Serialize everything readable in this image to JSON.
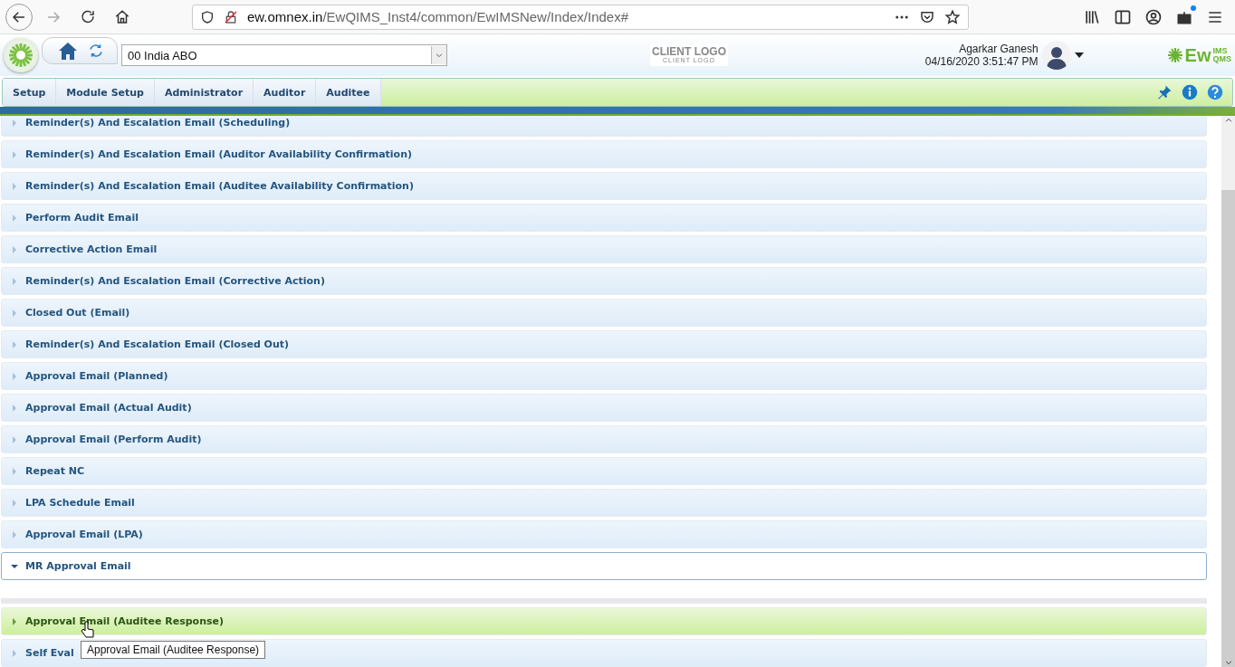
{
  "browser": {
    "url_host": "ew.omnex.in",
    "url_path": "/EwQIMS_Inst4/common/EwIMSNew/Index/Index#",
    "notification_dot": true
  },
  "header": {
    "site_select": "00 India ABO",
    "client_logo": "CLIENT LOGO",
    "client_logo_sub": "CLIENT LOGO",
    "user_name": "Agarkar Ganesh",
    "datetime": "04/16/2020 3:51:47 PM",
    "brand": "Ew",
    "brand_sup": "IMS",
    "brand_sub": "QMS"
  },
  "nav": {
    "items": [
      {
        "label": "Setup"
      },
      {
        "label": "Module Setup"
      },
      {
        "label": "Administrator"
      },
      {
        "label": "Auditor"
      },
      {
        "label": "Auditee"
      }
    ]
  },
  "sections": [
    {
      "label": "Reminder(s) And Escalation Email (Scheduling)",
      "expanded": false,
      "hovered": false
    },
    {
      "label": "Reminder(s) And Escalation Email (Auditor Availability Confirmation)",
      "expanded": false,
      "hovered": false
    },
    {
      "label": "Reminder(s) And Escalation Email (Auditee Availability Confirmation)",
      "expanded": false,
      "hovered": false
    },
    {
      "label": "Perform Audit Email",
      "expanded": false,
      "hovered": false
    },
    {
      "label": "Corrective Action Email",
      "expanded": false,
      "hovered": false
    },
    {
      "label": "Reminder(s) And Escalation Email (Corrective Action)",
      "expanded": false,
      "hovered": false
    },
    {
      "label": "Closed Out (Email)",
      "expanded": false,
      "hovered": false
    },
    {
      "label": "Reminder(s) And Escalation Email (Closed Out)",
      "expanded": false,
      "hovered": false
    },
    {
      "label": "Approval Email (Planned)",
      "expanded": false,
      "hovered": false
    },
    {
      "label": "Approval Email (Actual Audit)",
      "expanded": false,
      "hovered": false
    },
    {
      "label": "Approval Email (Perform Audit)",
      "expanded": false,
      "hovered": false
    },
    {
      "label": "Repeat NC",
      "expanded": false,
      "hovered": false
    },
    {
      "label": "LPA Schedule Email",
      "expanded": false,
      "hovered": false
    },
    {
      "label": "Approval Email (LPA)",
      "expanded": false,
      "hovered": false
    },
    {
      "label": "MR Approval Email",
      "expanded": true,
      "hovered": false
    },
    {
      "label": "Approval Email (Auditee Response)",
      "expanded": false,
      "hovered": true
    },
    {
      "label": "Self Eval",
      "expanded": false,
      "hovered": false
    }
  ],
  "tooltip": "Approval Email (Auditee Response)"
}
